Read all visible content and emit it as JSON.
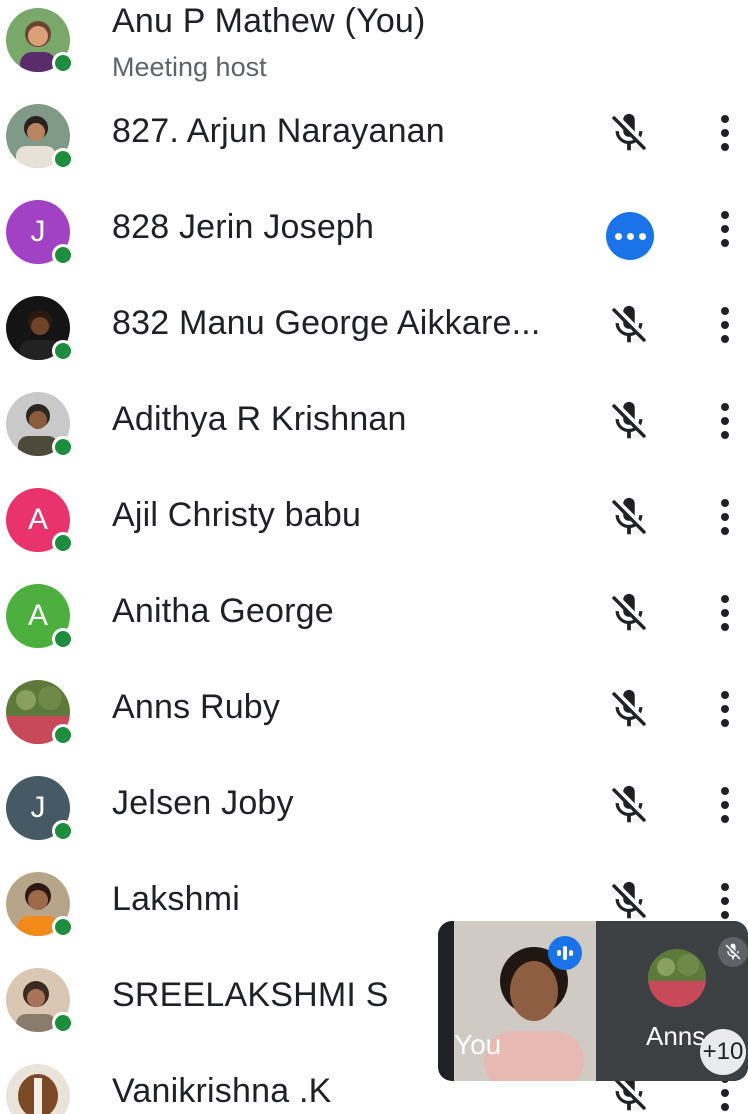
{
  "participants": [
    {
      "name": "Anu P Mathew (You)",
      "subtitle": "Meeting host"
    },
    {
      "name": "827. Arjun Narayanan",
      "status": "muted"
    },
    {
      "name": "828 Jerin Joseph",
      "status": "speaking"
    },
    {
      "name": "832 Manu George Aikkare...",
      "status": "muted"
    },
    {
      "name": "Adithya R Krishnan",
      "status": "muted"
    },
    {
      "name": "Ajil Christy babu",
      "initial": "A",
      "avatar_color": "#e8336d",
      "status": "muted"
    },
    {
      "name": "Anitha George",
      "initial": "A",
      "avatar_color": "#4caf3e",
      "status": "muted"
    },
    {
      "name": "Anns Ruby",
      "status": "muted"
    },
    {
      "name": "Jelsen Joby",
      "initial": "J",
      "avatar_color": "#455a64",
      "status": "muted"
    },
    {
      "name": "Lakshmi",
      "status": "muted"
    },
    {
      "name": "SREELAKSHMI S",
      "status": "muted"
    },
    {
      "name": "Vanikrishna .K",
      "status": "muted"
    }
  ],
  "jerin_initial": "J",
  "jerin_color": "#a142c4",
  "pip": {
    "self_label": "You",
    "other_label": "Anns",
    "more_count": "+10"
  },
  "colors": {
    "online": "#1e8e3e",
    "speaking": "#1a73e8",
    "text": "#202124",
    "subtext": "#5f6368"
  },
  "icons": [
    "mic-off-icon",
    "more-vert-icon",
    "speaking-dots-icon",
    "voice-activity-icon"
  ]
}
